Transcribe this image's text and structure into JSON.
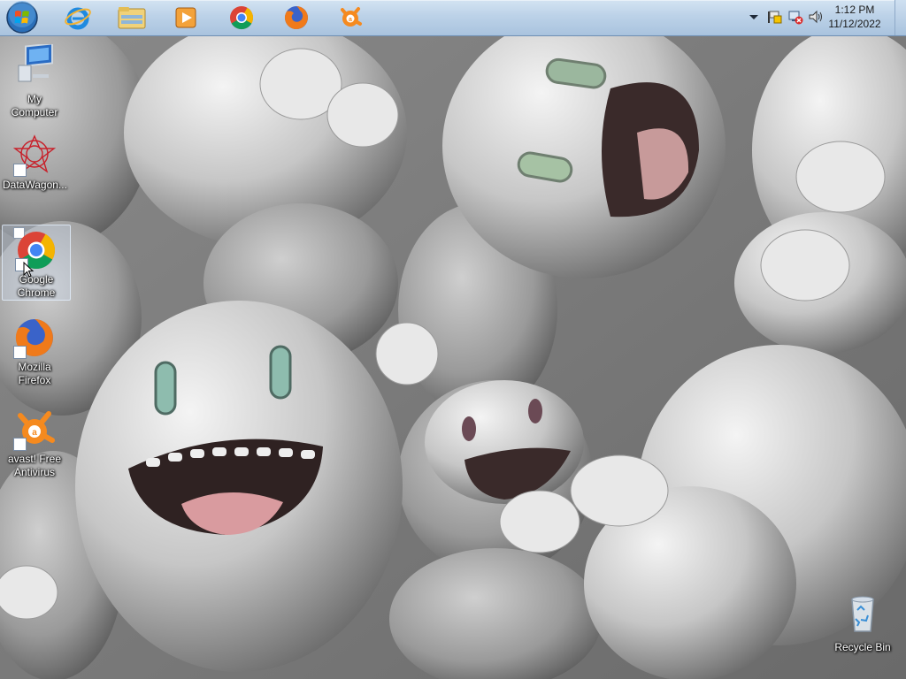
{
  "desktop": {
    "icons": [
      {
        "label": "My Computer"
      },
      {
        "label": "DataWagon..."
      },
      {
        "label": "Google Chrome"
      },
      {
        "label": "Mozilla Firefox"
      },
      {
        "label": "avast! Free Antivirus"
      },
      {
        "label": "Recycle Bin"
      }
    ]
  },
  "taskbar": {
    "start_icon": "windows-start-orb",
    "pinned": [
      {
        "icon": "internet-explorer-icon"
      },
      {
        "icon": "file-explorer-icon"
      },
      {
        "icon": "media-player-icon"
      },
      {
        "icon": "chrome-icon"
      },
      {
        "icon": "firefox-icon"
      },
      {
        "icon": "avast-icon"
      }
    ],
    "tray": {
      "icons": [
        "show-hidden-icons-chevron",
        "action-center-flag-icon",
        "network-disconnected-icon",
        "volume-icon"
      ],
      "time": "1:12 PM",
      "date": "11/12/2022"
    }
  },
  "colors": {
    "taskbar_top": "#d3e3f2",
    "taskbar_bottom": "#a9c3de",
    "wallpaper_base": "#8f8f8f"
  }
}
